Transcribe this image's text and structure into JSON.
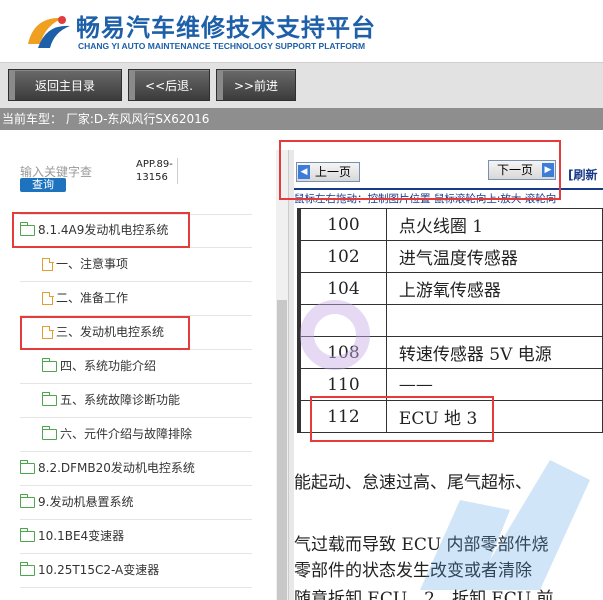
{
  "header": {
    "title_cn": "畅易汽车维修技术支持平台",
    "title_en": "CHANG YI AUTO MAINTENANCE TECHNOLOGY SUPPORT PLATFORM"
  },
  "toolbar": {
    "home_label": "返回主目录",
    "back_label": "<<后退.",
    "forward_label": ">>前进"
  },
  "model": {
    "text": "当前车型： 厂家:D-东风风行SX62016"
  },
  "search": {
    "placeholder": "输入关键字查",
    "button_label": "查询",
    "app_version": "APP.89-13156"
  },
  "tree": {
    "items": [
      {
        "label": "8.1.4A9发动机电控系统",
        "icon": "folder-icon",
        "level": 0,
        "highlighted": true
      },
      {
        "label": "一、注意事项",
        "icon": "document-icon",
        "level": 1
      },
      {
        "label": "二、准备工作",
        "icon": "document-icon",
        "level": 1
      },
      {
        "label": "三、发动机电控系统",
        "icon": "document-icon",
        "level": 1,
        "highlighted": true
      },
      {
        "label": "四、系统功能介绍",
        "icon": "folder-icon",
        "level": 1
      },
      {
        "label": "五、系统故障诊断功能",
        "icon": "folder-icon",
        "level": 1
      },
      {
        "label": "六、元件介绍与故障排除",
        "icon": "folder-icon",
        "level": 1
      },
      {
        "label": "8.2.DFMB20发动机电控系统",
        "icon": "folder-icon",
        "level": 0
      },
      {
        "label": "9.发动机悬置系统",
        "icon": "folder-icon",
        "level": 0
      },
      {
        "label": "10.1BE4变速器",
        "icon": "folder-icon",
        "level": 0
      },
      {
        "label": "10.25T15C2-A变速器",
        "icon": "folder-icon",
        "level": 0
      }
    ]
  },
  "doc": {
    "prev_label": "上一页",
    "next_label": "下一页",
    "refresh_label": "[刷新",
    "hint": "鼠标左右拖动：控制图片位置  鼠标滚轮向上:放大  滚轮向",
    "rows": [
      {
        "num": "100",
        "name": "点火线圈 1"
      },
      {
        "num": "102",
        "name": "进气温度传感器"
      },
      {
        "num": "104",
        "name": "上游氧传感器"
      },
      {
        "num": "",
        "name": ""
      },
      {
        "num": "108",
        "name": "转速传感器 5V 电源"
      },
      {
        "num": "110",
        "name": "——"
      },
      {
        "num": "112",
        "name": "ECU 地 3"
      }
    ],
    "para1": "能起动、怠速过高、尾气超标、",
    "para2": "气过载而导致 ECU 内部零部件烧",
    "para3": "零部件的状态发生改变或者清除",
    "para4": "随意拆卸 ECU。2．拆卸 ECU 前"
  },
  "colors": {
    "brand_blue": "#1d5fa8",
    "highlight_red": "#e23c3c",
    "toolbar_dark": "#3b3b3b"
  }
}
